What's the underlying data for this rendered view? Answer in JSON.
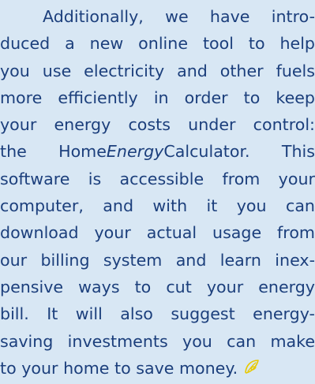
{
  "article": {
    "lines": [
      "Additionally, we have intro-",
      "duced a new online tool to help",
      "you use electricity and other fuels",
      "more efficiently in order to keep",
      "your energy costs under control:",
      "the Home",
      "Energy",
      "Calculator. This",
      "software is accessible from your",
      "computer, and with it you can",
      "download your actual usage from",
      "our billing system and learn inex-",
      "pensive ways to cut your energy",
      "bill. It will also suggest energy-",
      "saving investments you can make",
      "to your home to save money."
    ]
  },
  "colors": {
    "background": "#d8e7f4",
    "text": "#1c3f7c",
    "end_mark": "#e8c900"
  },
  "icons": {
    "end_mark": "leaf-swirl-icon"
  }
}
